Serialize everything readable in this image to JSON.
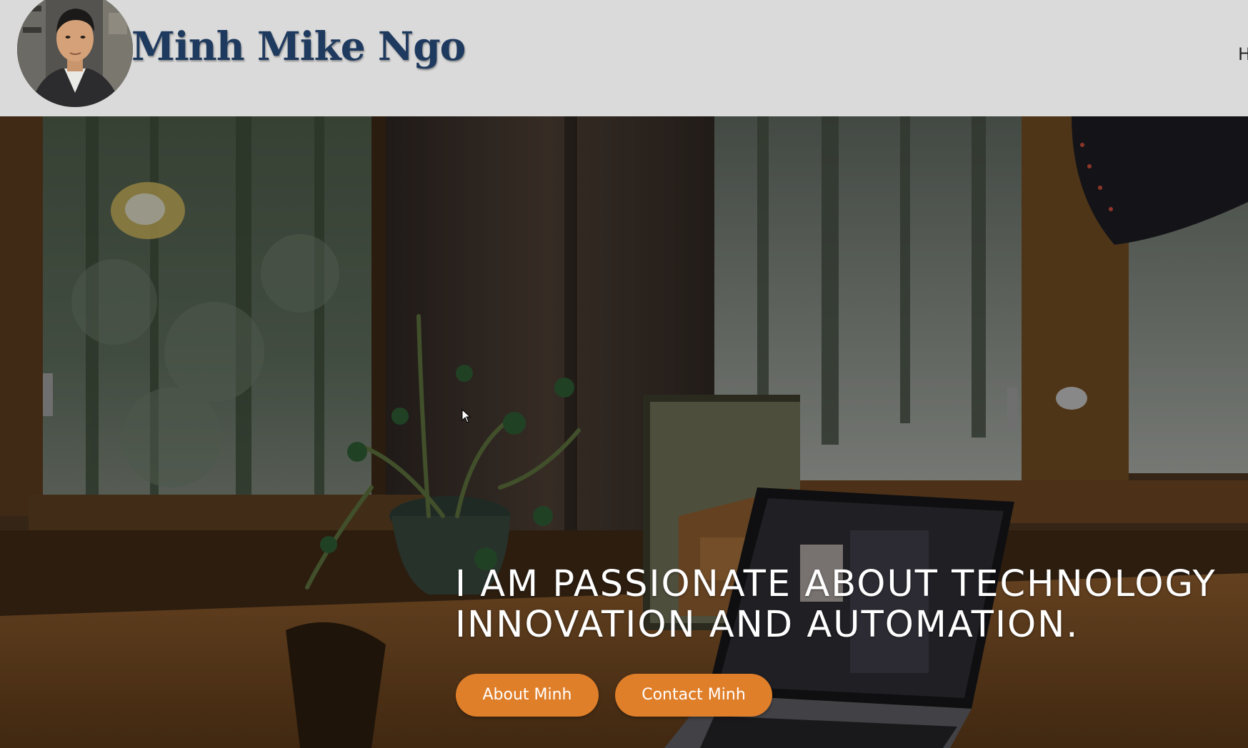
{
  "header": {
    "brand_name": "Minh Mike Ngo",
    "nav_peek_text": "H",
    "avatar_icon": "person-photo"
  },
  "hero": {
    "headline_line1": "I AM PASSIONATE ABOUT TECHNOLOGY",
    "headline_line2": "INNOVATION AND AUTOMATION.",
    "buttons": [
      {
        "label": "About Minh"
      },
      {
        "label": "Contact Minh"
      }
    ]
  },
  "colors": {
    "header_bg": "#dadada",
    "brand_text": "#1f3a5f",
    "button_bg": "#e07f2a",
    "headline_text": "#ffffff"
  }
}
